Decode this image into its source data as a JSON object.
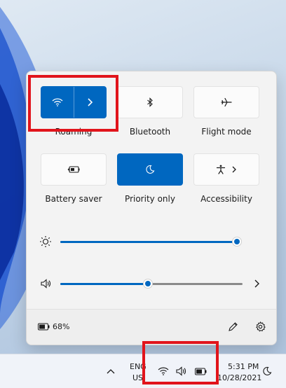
{
  "quick_settings": {
    "tiles_row1": [
      {
        "label": "Roaming",
        "icon": "wifi-icon",
        "state": "on"
      },
      {
        "label": "Bluetooth",
        "icon": "bluetooth-icon",
        "state": "off"
      },
      {
        "label": "Flight mode",
        "icon": "airplane-icon",
        "state": "off"
      }
    ],
    "tiles_row2": [
      {
        "label": "Battery saver",
        "icon": "battery-saver-icon",
        "state": "off"
      },
      {
        "label": "Priority only",
        "icon": "moon-icon",
        "state": "on"
      },
      {
        "label": "Accessibility",
        "icon": "accessibility-icon",
        "state": "off"
      }
    ],
    "brightness": {
      "icon": "sun-icon",
      "level_percent": 100
    },
    "volume": {
      "icon": "speaker-icon",
      "level_percent": 48
    },
    "battery": {
      "icon": "battery-icon",
      "text": "68%"
    },
    "footer_icons": [
      "pencil-edit-icon",
      "gear-icon"
    ]
  },
  "taskbar": {
    "lang_line1": "ENG",
    "lang_line2": "US",
    "time": "5:31 PM",
    "date": "10/28/2021",
    "tray_icons": [
      "chevron-up-icon",
      "wifi-icon",
      "speaker-icon",
      "battery-icon",
      "moon-icon"
    ]
  },
  "colors": {
    "accent": "#0067c0",
    "highlight": "#e1141b"
  }
}
